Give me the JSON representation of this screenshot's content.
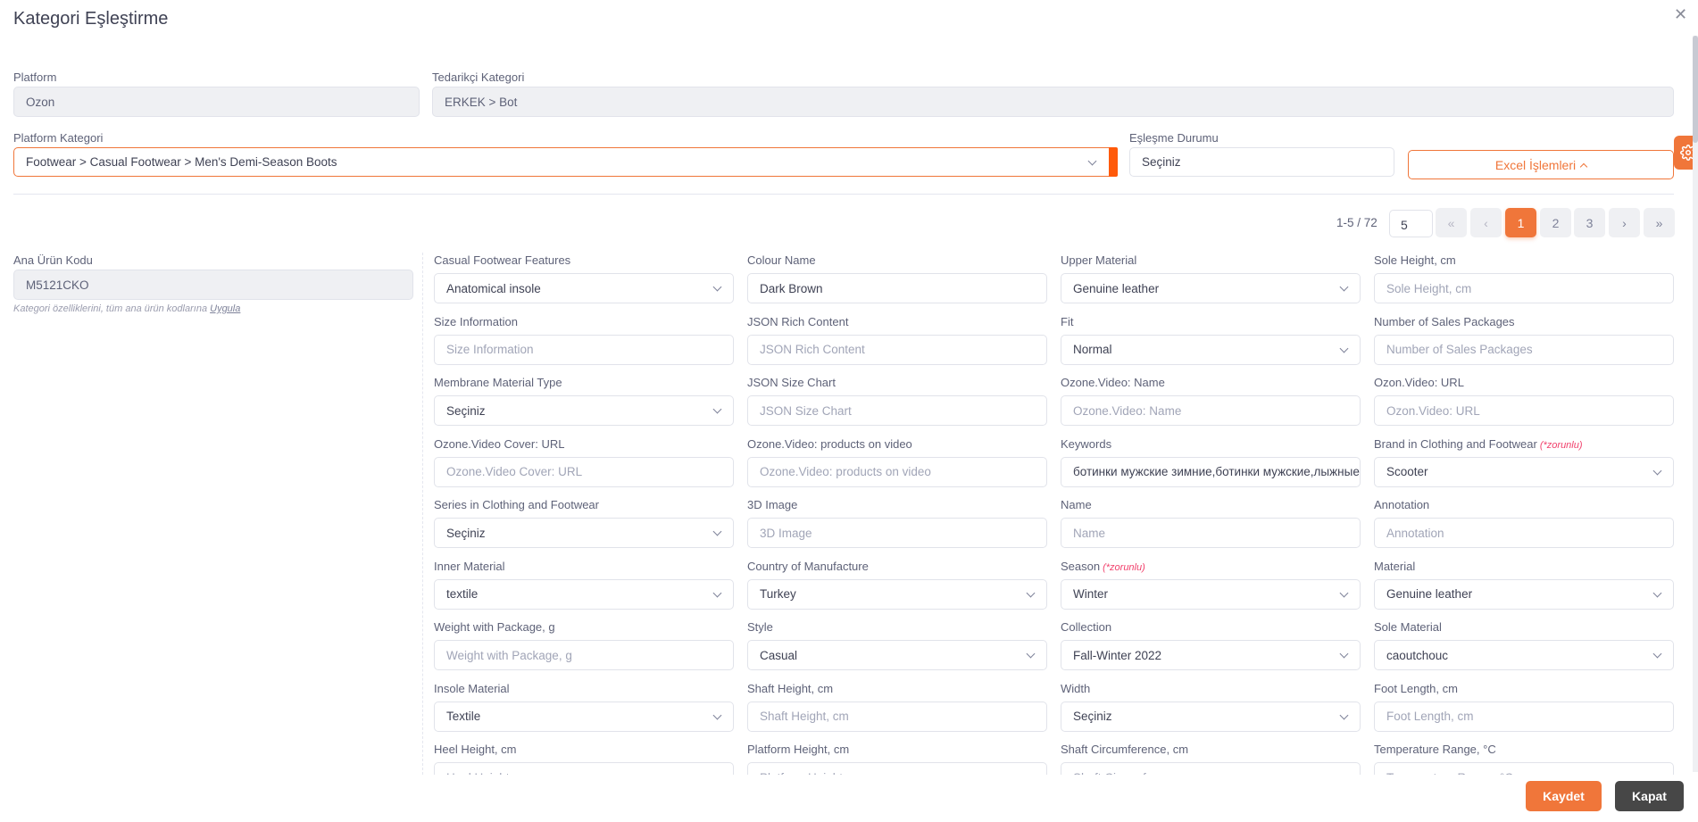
{
  "modal": {
    "title": "Kategori Eşleştirme",
    "close_icon": "close-icon"
  },
  "header": {
    "platform": {
      "label": "Platform",
      "value": "Ozon"
    },
    "supplier_category": {
      "label": "Tedarikçi Kategori",
      "value": "ERKEK > Bot"
    },
    "platform_category": {
      "label": "Platform Kategori",
      "value": "Footwear > Casual Footwear > Men's Demi-Season Boots"
    },
    "match_status": {
      "label": "Eşleşme Durumu",
      "value": "Seçiniz"
    },
    "excel_button": "Excel İşlemleri"
  },
  "pagination": {
    "info": "1-5 / 72",
    "page_size": "5",
    "first": "«",
    "prev": "‹",
    "pages": [
      "1",
      "2",
      "3"
    ],
    "current_page": "1",
    "next": "›",
    "last": "»"
  },
  "product": {
    "label": "Ana Ürün Kodu",
    "value": "M5121CKO",
    "hint": "Kategori özelliklerini, tüm ana ürün kodlarına",
    "hint_link": "Uygula"
  },
  "required_tag": "(*zorunlu)",
  "fields": [
    {
      "label": "Casual Footwear Features",
      "type": "select",
      "value": "Anatomical insole"
    },
    {
      "label": "Colour Name",
      "type": "input",
      "value": "Dark Brown"
    },
    {
      "label": "Upper Material",
      "type": "select",
      "value": "Genuine leather"
    },
    {
      "label": "Sole Height, cm",
      "type": "input",
      "placeholder": "Sole Height, cm"
    },
    {
      "label": "Size Information",
      "type": "input",
      "placeholder": "Size Information"
    },
    {
      "label": "JSON Rich Content",
      "type": "input",
      "placeholder": "JSON Rich Content"
    },
    {
      "label": "Fit",
      "type": "select",
      "value": "Normal"
    },
    {
      "label": "Number of Sales Packages",
      "type": "input",
      "placeholder": "Number of Sales Packages"
    },
    {
      "label": "Membrane Material Type",
      "type": "select",
      "value": "Seçiniz"
    },
    {
      "label": "JSON Size Chart",
      "type": "input",
      "placeholder": "JSON Size Chart"
    },
    {
      "label": "Ozone.Video: Name",
      "type": "input",
      "placeholder": "Ozone.Video: Name"
    },
    {
      "label": "Ozon.Video: URL",
      "type": "input",
      "placeholder": "Ozon.Video: URL"
    },
    {
      "label": "Ozone.Video Cover: URL",
      "type": "input",
      "placeholder": "Ozone.Video Cover: URL"
    },
    {
      "label": "Ozone.Video: products on video",
      "type": "input",
      "placeholder": "Ozone.Video: products on video"
    },
    {
      "label": "Keywords",
      "type": "input",
      "value": "ботинки мужские зимние,ботинки мужские,лыжные"
    },
    {
      "label": "Brand in Clothing and Footwear",
      "type": "select",
      "value": "Scooter",
      "required": true
    },
    {
      "label": "Series in Clothing and Footwear",
      "type": "select",
      "value": "Seçiniz"
    },
    {
      "label": "3D Image",
      "type": "input",
      "placeholder": "3D Image"
    },
    {
      "label": "Name",
      "type": "input",
      "placeholder": "Name"
    },
    {
      "label": "Annotation",
      "type": "input",
      "placeholder": "Annotation"
    },
    {
      "label": "Inner Material",
      "type": "select",
      "value": "textile"
    },
    {
      "label": "Country of Manufacture",
      "type": "select",
      "value": "Turkey"
    },
    {
      "label": "Season",
      "type": "select",
      "value": "Winter",
      "required": true
    },
    {
      "label": "Material",
      "type": "select",
      "value": "Genuine leather"
    },
    {
      "label": "Weight with Package, g",
      "type": "input",
      "placeholder": "Weight with Package, g"
    },
    {
      "label": "Style",
      "type": "select",
      "value": "Casual"
    },
    {
      "label": "Collection",
      "type": "select",
      "value": "Fall-Winter 2022"
    },
    {
      "label": "Sole Material",
      "type": "select",
      "value": "caoutchouc"
    },
    {
      "label": "Insole Material",
      "type": "select",
      "value": "Textile"
    },
    {
      "label": "Shaft Height, cm",
      "type": "input",
      "placeholder": "Shaft Height, cm"
    },
    {
      "label": "Width",
      "type": "select",
      "value": "Seçiniz"
    },
    {
      "label": "Foot Length, cm",
      "type": "input",
      "placeholder": "Foot Length, cm"
    },
    {
      "label": "Heel Height, cm",
      "type": "input",
      "placeholder": "Heel Height, cm"
    },
    {
      "label": "Platform Height, cm",
      "type": "input",
      "placeholder": "Platform Height, cm"
    },
    {
      "label": "Shaft Circumference, cm",
      "type": "input",
      "placeholder": "Shaft Circumference, cm"
    },
    {
      "label": "Temperature Range, °C",
      "type": "input",
      "placeholder": "Temperature Range, °C"
    }
  ],
  "footer": {
    "save": "Kaydet",
    "close": "Kapat"
  },
  "colors": {
    "accent": "#f0763a",
    "required": "#f1416c",
    "close_button": "#474747"
  }
}
